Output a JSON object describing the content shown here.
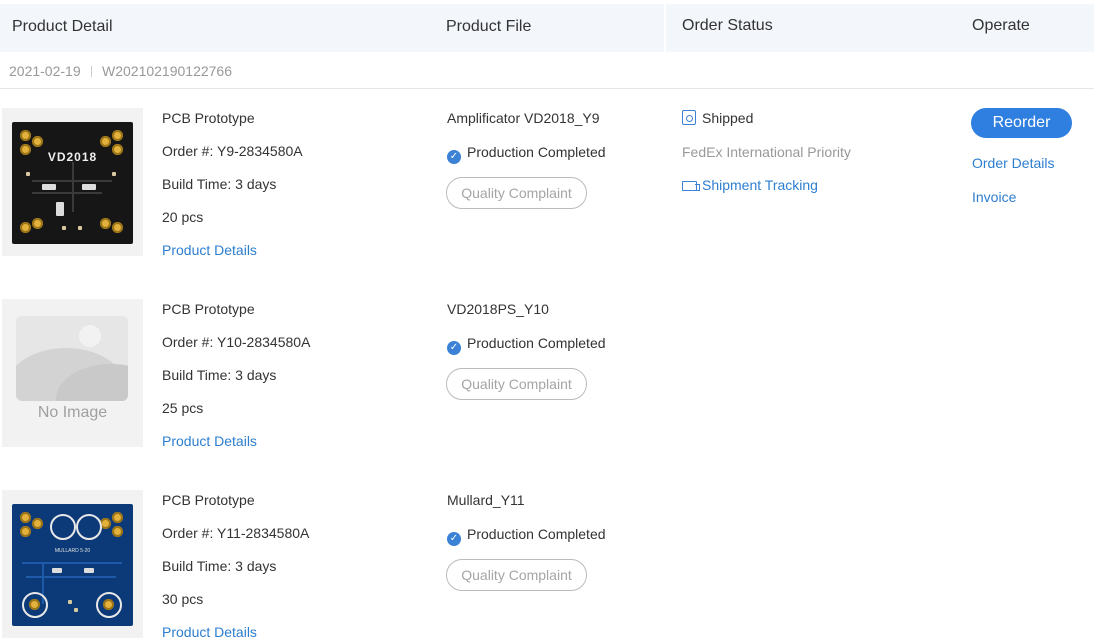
{
  "header": {
    "product_detail": "Product Detail",
    "product_file": "Product File",
    "order_status": "Order Status",
    "operate": "Operate"
  },
  "order": {
    "date": "2021-02-19",
    "number": "W202102190122766"
  },
  "items": [
    {
      "thumbnail": "pcb-black",
      "type": "PCB Prototype",
      "order_no": "Order #: Y9-2834580A",
      "build_time": "Build Time: 3 days",
      "quantity": "20 pcs",
      "details_link": "Product Details",
      "file_name": "Amplificator VD2018_Y9",
      "production_status": "Production Completed",
      "complaint_label": "Quality Complaint"
    },
    {
      "thumbnail": "no-image",
      "no_image_label": "No Image",
      "type": "PCB Prototype",
      "order_no": "Order #: Y10-2834580A",
      "build_time": "Build Time: 3 days",
      "quantity": "25 pcs",
      "details_link": "Product Details",
      "file_name": "VD2018PS_Y10",
      "production_status": "Production Completed",
      "complaint_label": "Quality Complaint"
    },
    {
      "thumbnail": "pcb-blue",
      "type": "PCB Prototype",
      "order_no": "Order #: Y11-2834580A",
      "build_time": "Build Time: 3 days",
      "quantity": "30 pcs",
      "details_link": "Product Details",
      "file_name": "Mullard_Y11",
      "production_status": "Production Completed",
      "complaint_label": "Quality Complaint"
    }
  ],
  "status": {
    "state": "Shipped",
    "carrier": "FedEx International Priority",
    "tracking_link": "Shipment Tracking"
  },
  "operate": {
    "reorder": "Reorder",
    "order_details": "Order Details",
    "invoice": "Invoice"
  },
  "colors": {
    "accent": "#2f7fe0",
    "link": "#2d7ecf",
    "header_bg": "#f3f6fb",
    "muted": "#999999"
  },
  "pcb_silkscreen": {
    "board1": "VD2018",
    "board3": "MULLARD 5-20"
  }
}
